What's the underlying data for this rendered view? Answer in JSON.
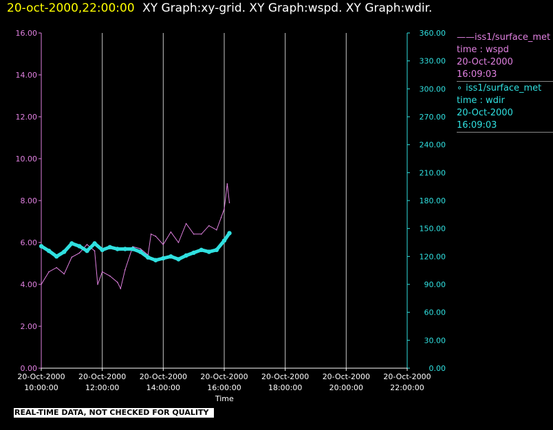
{
  "header": {
    "date_label": "20-oct-2000,22:00:00",
    "titles": "XY Graph:xy-grid.  XY Graph:wspd.  XY Graph:wdir."
  },
  "status_banner": "REAL-TIME DATA, NOT CHECKED FOR QUALITY",
  "legend": [
    {
      "marker": "——",
      "source": "iss1/surface_met",
      "var": "time : wspd",
      "date": "20-Oct-2000",
      "time": "16:09:03",
      "color": "#e080e0"
    },
    {
      "marker": "∘",
      "source": "iss1/surface_met",
      "var": "time : wdir",
      "date": "20-Oct-2000",
      "time": "16:09:03",
      "color": "#30e0e0"
    }
  ],
  "chart_data": {
    "type": "line",
    "xlabel": "Time",
    "x_range": [
      "20-Oct-2000 10:00:00",
      "20-Oct-2000 22:00:00"
    ],
    "x_ticks": [
      {
        "date": "20-Oct-2000",
        "time": "10:00:00",
        "hour": 10
      },
      {
        "date": "20-Oct-2000",
        "time": "12:00:00",
        "hour": 12
      },
      {
        "date": "20-Oct-2000",
        "time": "14:00:00",
        "hour": 14
      },
      {
        "date": "20-Oct-2000",
        "time": "16:00:00",
        "hour": 16
      },
      {
        "date": "20-Oct-2000",
        "time": "18:00:00",
        "hour": 18
      },
      {
        "date": "20-Oct-2000",
        "time": "20:00:00",
        "hour": 20
      },
      {
        "date": "20-Oct-2000",
        "time": "22:00:00",
        "hour": 22
      }
    ],
    "y_left": {
      "range": [
        0,
        16
      ],
      "ticks": [
        "0.00",
        "2.00",
        "4.00",
        "6.00",
        "8.00",
        "10.00",
        "12.00",
        "14.00",
        "16.00"
      ],
      "color": "#e080e0"
    },
    "y_right": {
      "range": [
        0,
        360
      ],
      "ticks": [
        "0.00",
        "30.00",
        "60.00",
        "90.00",
        "120.00",
        "150.00",
        "180.00",
        "210.00",
        "240.00",
        "270.00",
        "300.00",
        "330.00",
        "360.00"
      ],
      "color": "#30e0e0"
    },
    "grid": "vertical",
    "series": [
      {
        "name": "iss1/surface_met time : wspd",
        "axis": "left",
        "style": "line",
        "color": "#e080e0",
        "x_hours": [
          10.0,
          10.25,
          10.5,
          10.75,
          11.0,
          11.25,
          11.5,
          11.75,
          11.85,
          12.0,
          12.25,
          12.5,
          12.6,
          12.75,
          13.0,
          13.25,
          13.5,
          13.6,
          13.75,
          14.0,
          14.25,
          14.5,
          14.75,
          15.0,
          15.25,
          15.5,
          15.75,
          15.9,
          16.0,
          16.1,
          16.17
        ],
        "values": [
          4.0,
          4.6,
          4.8,
          4.5,
          5.3,
          5.5,
          5.9,
          5.6,
          4.0,
          4.6,
          4.4,
          4.1,
          3.8,
          4.7,
          5.8,
          5.7,
          5.4,
          6.4,
          6.3,
          5.9,
          6.5,
          6.0,
          6.9,
          6.4,
          6.4,
          6.8,
          6.6,
          7.2,
          7.6,
          8.8,
          7.9
        ]
      },
      {
        "name": "iss1/surface_met time : wdir",
        "axis": "right",
        "style": "markers",
        "color": "#30e0e0",
        "x_hours": [
          10.0,
          10.25,
          10.5,
          10.75,
          11.0,
          11.25,
          11.5,
          11.75,
          12.0,
          12.25,
          12.5,
          12.75,
          13.0,
          13.25,
          13.5,
          13.75,
          14.0,
          14.25,
          14.5,
          14.75,
          15.0,
          15.25,
          15.5,
          15.75,
          16.0,
          16.17
        ],
        "values": [
          131,
          126,
          120,
          125,
          134,
          131,
          126,
          134,
          127,
          130,
          128,
          128,
          128,
          125,
          119,
          116,
          118,
          120,
          117,
          121,
          124,
          127,
          125,
          127,
          137,
          145
        ]
      }
    ]
  }
}
